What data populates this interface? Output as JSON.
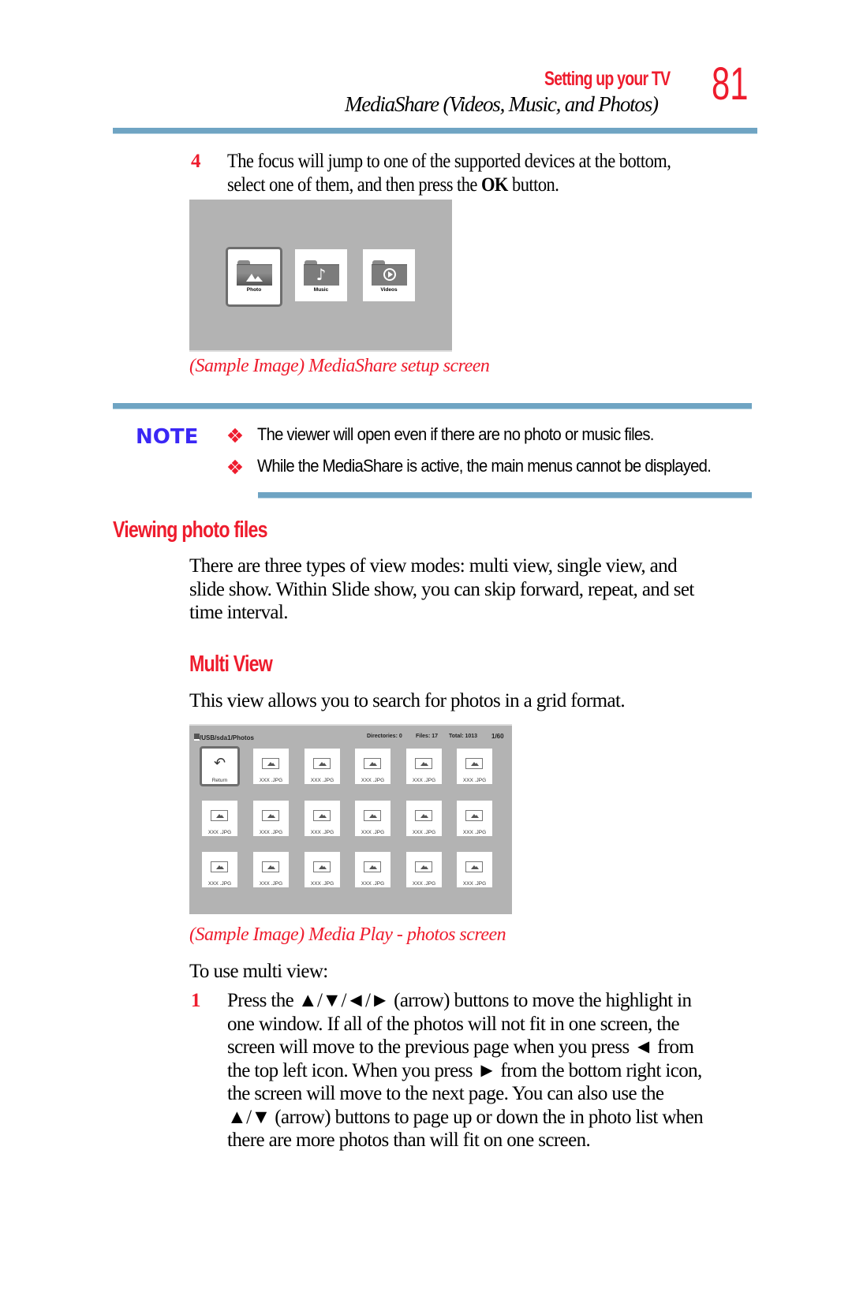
{
  "header": {
    "chapter": "Setting up your TV",
    "section": "MediaShare (Videos, Music, and Photos)",
    "page_number": "81"
  },
  "step4": {
    "number": "4",
    "line1": "The focus will jump to one of the supported devices at the bottom,",
    "line2_pre": "select one of them, and then press the ",
    "line2_bold": "OK",
    "line2_post": " button."
  },
  "setup_screen": {
    "tiles": [
      {
        "label": "Photo",
        "icon": "photo-folder-icon",
        "selected": true
      },
      {
        "label": "Music",
        "icon": "music-folder-icon",
        "selected": false
      },
      {
        "label": "Videos",
        "icon": "video-folder-icon",
        "selected": false
      }
    ],
    "caption": "(Sample Image) MediaShare setup screen"
  },
  "note": {
    "label": "NOTE",
    "items": [
      "The viewer will open even if there are no photo or music files.",
      "While the MediaShare is active, the main menus cannot be displayed."
    ]
  },
  "viewing": {
    "heading": "Viewing photo files",
    "paragraph_lines": [
      "There are three types of view modes: multi view, single view, and",
      "slide show. Within Slide show, you can skip forward, repeat, and set",
      "time interval."
    ]
  },
  "multi_view": {
    "heading": "Multi View",
    "intro": "This view allows you to search for photos in a grid format."
  },
  "grid_screen": {
    "path": "/USB/sda1/Photos",
    "directories": "Directories: 0",
    "files": "Files: 17",
    "total": "Total: 1013",
    "page": "1/60",
    "return_label": "Return",
    "file_label": "XXX .JPG",
    "caption": "(Sample Image) Media Play - photos screen"
  },
  "instructions": {
    "lead": "To use multi view:",
    "step_number": "1",
    "lines": [
      "Press the ▲/▼/◄/► (arrow) buttons to move the highlight in",
      "one window. If all of the photos will not fit in one screen, the",
      "screen will move to the previous page when you press ◄ from",
      "the top left icon. When you press ► from the bottom right icon,",
      "the screen will move to the next page. You can also use the",
      "▲/▼ (arrow) buttons to page up or down the in photo list when",
      "there are more photos than will fit on one screen."
    ]
  },
  "colors": {
    "accent_red": "#ee1c2d",
    "rule_blue": "#6fa4c3",
    "note_blue": "#3a27f5"
  }
}
